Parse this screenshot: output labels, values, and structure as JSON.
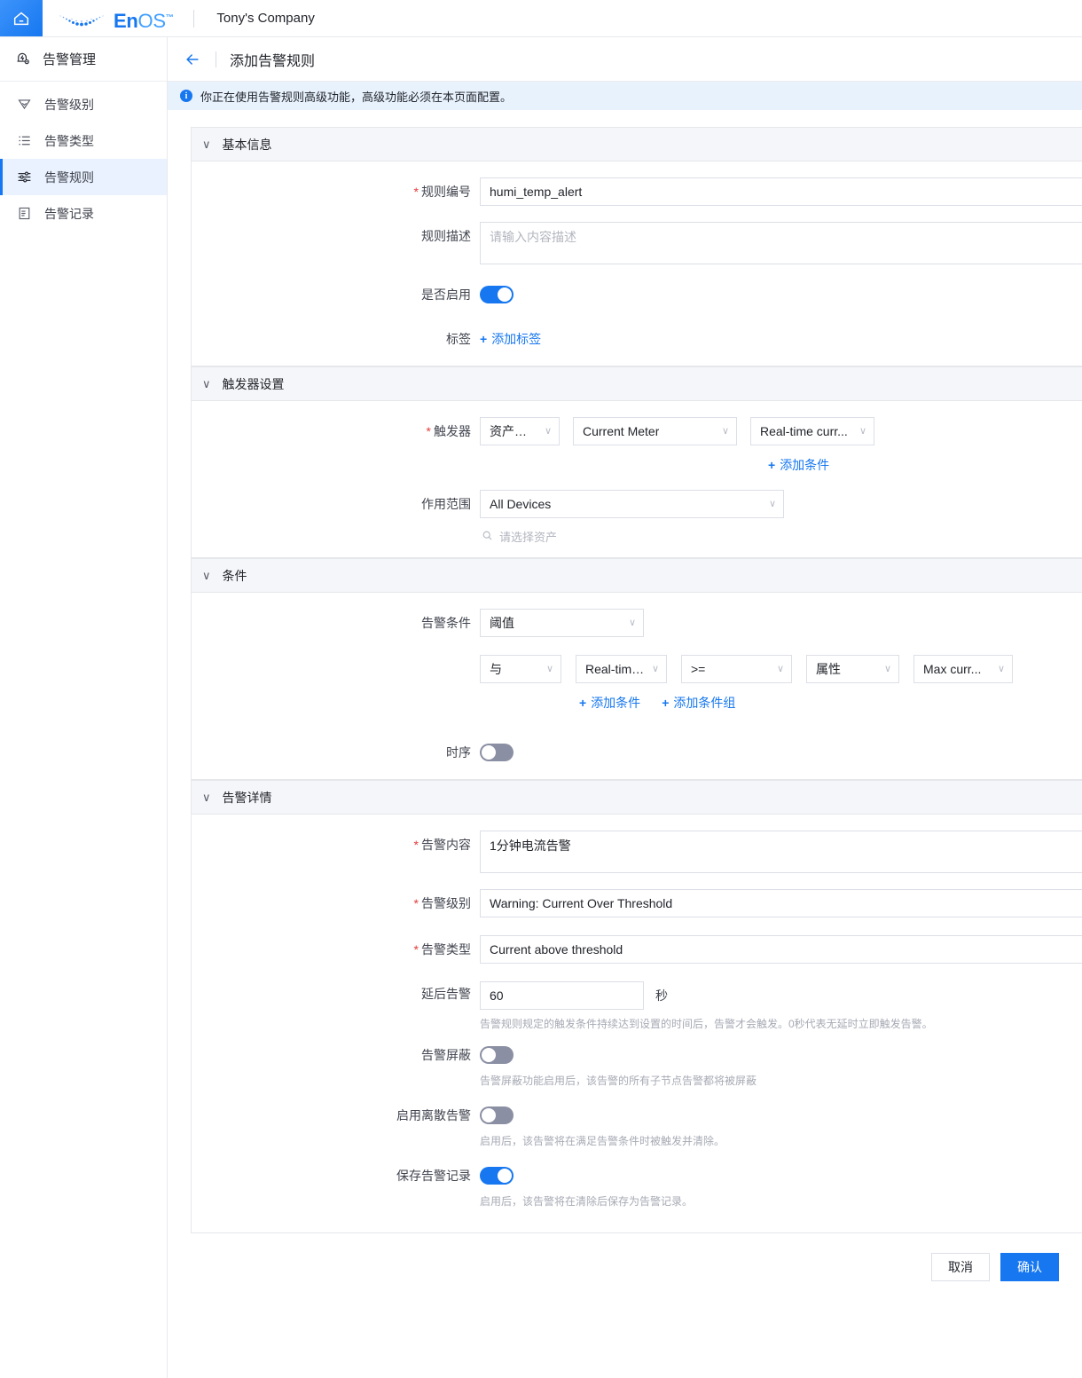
{
  "colors": {
    "accent": "#1677f0",
    "toggle_on": "#1677f0",
    "toggle_off": "#8b8fa3",
    "notice_bg": "#e8f2fd",
    "section_header_bg": "#f5f6f9",
    "required_star": "#e63c3c",
    "active_item_bg": "#e9f2fe"
  },
  "topbar": {
    "home_icon": "home-icon",
    "logo_text_en": "En",
    "logo_text_os": "OS",
    "logo_tm": "™",
    "company": "Tony's Company"
  },
  "sidebar": {
    "header": {
      "icon": "alarm-management-icon",
      "label": "告警管理"
    },
    "items": [
      {
        "icon": "shield-level-icon",
        "label": "告警级别",
        "active": false
      },
      {
        "icon": "list-icon",
        "label": "告警类型",
        "active": false
      },
      {
        "icon": "sliders-icon",
        "label": "告警规则",
        "active": true
      },
      {
        "icon": "document-icon",
        "label": "告警记录",
        "active": false
      }
    ]
  },
  "page": {
    "back_icon": "back-arrow-icon",
    "title": "添加告警规则",
    "notice_icon": "info-icon",
    "notice": "你正在使用告警规则高级功能，高级功能必须在本页面配置。"
  },
  "basic_info": {
    "section_title": "基本信息",
    "chevron": "chevron-down-icon",
    "rule_id": {
      "label": "规则编号",
      "required": true,
      "value": "humi_temp_alert"
    },
    "rule_desc": {
      "label": "规则描述",
      "required": false,
      "value": "",
      "placeholder": "请输入内容描述",
      "globe_icon": "globe-icon"
    },
    "enabled": {
      "label": "是否启用",
      "on": true
    },
    "tags": {
      "label": "标签",
      "add_label": "添加标签",
      "plus": "+"
    }
  },
  "trigger": {
    "section_title": "触发器设置",
    "chevron": "chevron-down-icon",
    "trigger_label": "触发器",
    "trigger_required": true,
    "selects": [
      "资产测点",
      "Current Meter",
      "Real-time curr..."
    ],
    "add_condition": "添加条件",
    "plus": "+",
    "scope_label": "作用范围",
    "scope_value": "All Devices",
    "search_placeholder": "请选择资产",
    "search_icon": "search-icon"
  },
  "condition": {
    "section_title": "条件",
    "chevron": "chevron-down-icon",
    "alarm_condition_label": "告警条件",
    "alarm_condition_value": "阈值",
    "rule_selects": [
      "与",
      "Real-time...",
      ">=",
      "属性",
      "Max curr..."
    ],
    "add_condition": "添加条件",
    "add_condition_group": "添加条件组",
    "plus": "+",
    "timing_label": "时序",
    "timing_on": false
  },
  "alarm_detail": {
    "section_title": "告警详情",
    "chevron": "chevron-down-icon",
    "content": {
      "label": "告警内容",
      "required": true,
      "value": "1分钟电流告警",
      "globe_icon": "globe-icon"
    },
    "level": {
      "label": "告警级别",
      "required": true,
      "value": "Warning: Current Over Threshold"
    },
    "type": {
      "label": "告警类型",
      "required": true,
      "value": "Current above threshold"
    },
    "delay": {
      "label": "延后告警",
      "value": "60",
      "unit": "秒",
      "hint": "告警规则规定的触发条件持续达到设置的时间后，告警才会触发。0秒代表无延时立即触发告警。"
    },
    "mask": {
      "label": "告警屏蔽",
      "on": false,
      "hint": "告警屏蔽功能启用后，该告警的所有子节点告警都将被屏蔽"
    },
    "discrete": {
      "label": "启用离散告警",
      "on": false,
      "hint": "启用后，该告警将在满足告警条件时被触发并清除。"
    },
    "save_record": {
      "label": "保存告警记录",
      "on": true,
      "hint": "启用后，该告警将在清除后保存为告警记录。"
    }
  },
  "footer": {
    "cancel": "取消",
    "confirm": "确认"
  }
}
